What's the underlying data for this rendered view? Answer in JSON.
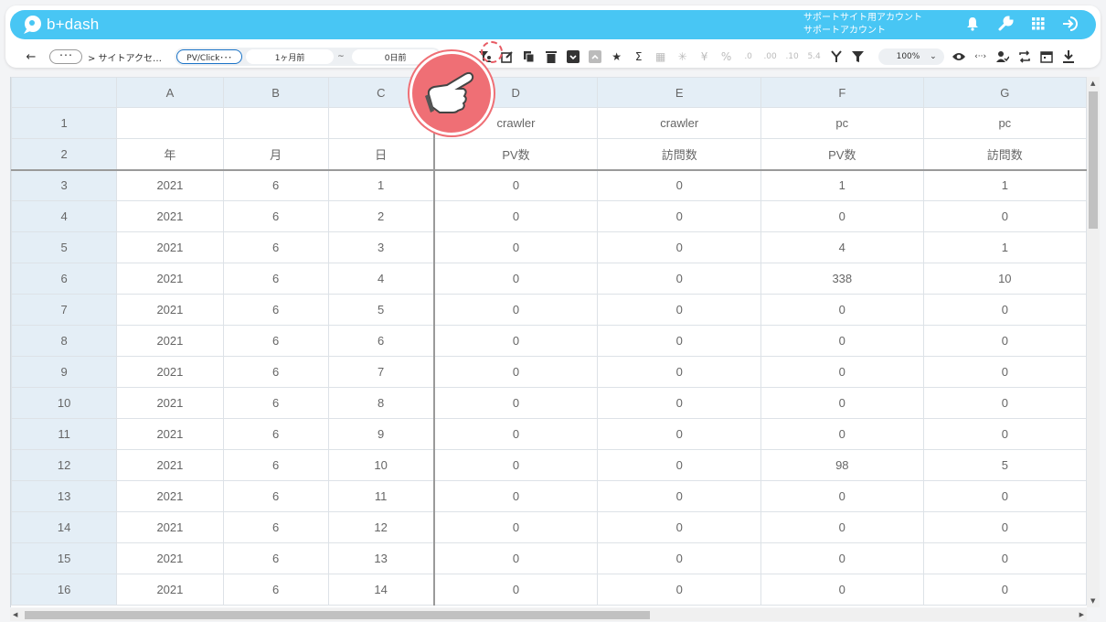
{
  "app": {
    "logo_text": "b+dash",
    "brand_color": "#48c6f4"
  },
  "account": {
    "line1": "サポートサイト用アカウント",
    "line2": "サポートアカウント"
  },
  "top_icons": [
    "bell-icon",
    "wrench-icon",
    "apps-grid-icon",
    "logout-icon"
  ],
  "toolbar": {
    "back_label": "←",
    "more_label": "･･･",
    "breadcrumb": "> サイトアクセ…",
    "report_pill": "PV/Click･･･",
    "date_from": "1ヶ月前",
    "tilde": "~",
    "date_to": "0日前",
    "zoom": "100%",
    "highlight_color": "#e85a63"
  },
  "sheet": {
    "columns": [
      "",
      "A",
      "B",
      "C",
      "D",
      "E",
      "F",
      "G"
    ],
    "rows": [
      {
        "n": "1",
        "cells": [
          "",
          "",
          "",
          "crawler",
          "crawler",
          "pc",
          "pc"
        ]
      },
      {
        "n": "2",
        "cells": [
          "年",
          "月",
          "日",
          "PV数",
          "訪問数",
          "PV数",
          "訪問数"
        ]
      },
      {
        "n": "3",
        "cells": [
          "2021",
          "6",
          "1",
          "0",
          "0",
          "1",
          "1"
        ]
      },
      {
        "n": "4",
        "cells": [
          "2021",
          "6",
          "2",
          "0",
          "0",
          "0",
          "0"
        ]
      },
      {
        "n": "5",
        "cells": [
          "2021",
          "6",
          "3",
          "0",
          "0",
          "4",
          "1"
        ]
      },
      {
        "n": "6",
        "cells": [
          "2021",
          "6",
          "4",
          "0",
          "0",
          "338",
          "10"
        ]
      },
      {
        "n": "7",
        "cells": [
          "2021",
          "6",
          "5",
          "0",
          "0",
          "0",
          "0"
        ]
      },
      {
        "n": "8",
        "cells": [
          "2021",
          "6",
          "6",
          "0",
          "0",
          "0",
          "0"
        ]
      },
      {
        "n": "9",
        "cells": [
          "2021",
          "6",
          "7",
          "0",
          "0",
          "0",
          "0"
        ]
      },
      {
        "n": "10",
        "cells": [
          "2021",
          "6",
          "8",
          "0",
          "0",
          "0",
          "0"
        ]
      },
      {
        "n": "11",
        "cells": [
          "2021",
          "6",
          "9",
          "0",
          "0",
          "0",
          "0"
        ]
      },
      {
        "n": "12",
        "cells": [
          "2021",
          "6",
          "10",
          "0",
          "0",
          "98",
          "5"
        ]
      },
      {
        "n": "13",
        "cells": [
          "2021",
          "6",
          "11",
          "0",
          "0",
          "0",
          "0"
        ]
      },
      {
        "n": "14",
        "cells": [
          "2021",
          "6",
          "12",
          "0",
          "0",
          "0",
          "0"
        ]
      },
      {
        "n": "15",
        "cells": [
          "2021",
          "6",
          "13",
          "0",
          "0",
          "0",
          "0"
        ]
      },
      {
        "n": "16",
        "cells": [
          "2021",
          "6",
          "14",
          "0",
          "0",
          "0",
          "0"
        ]
      }
    ]
  }
}
